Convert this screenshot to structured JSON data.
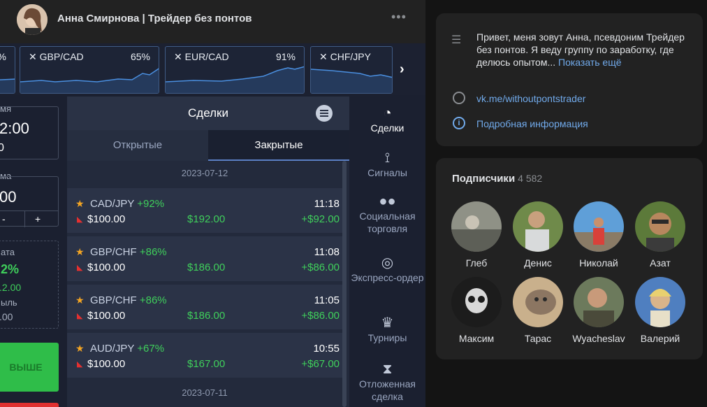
{
  "post": {
    "author": "Анна Смирнова | Трейдер без понтов",
    "menu": "•••"
  },
  "ticker": {
    "items": [
      {
        "pair": "",
        "percent": "%"
      },
      {
        "pair": "GBP/CAD",
        "percent": "65%"
      },
      {
        "pair": "EUR/CAD",
        "percent": "91%"
      },
      {
        "pair": "CHF/JPY",
        "percent": ""
      }
    ],
    "next": "›"
  },
  "left_panel": {
    "time_label": "мя",
    "time_value": "2:00",
    "time_sub": "0",
    "amount_label": "ма",
    "amount_value": "00",
    "minus": "-",
    "plus": "+",
    "payout_label": "ата",
    "payout_pct": "2%",
    "payout_value": ".2.00",
    "profit_label": "ыль",
    "profit_value": ".00",
    "up_button": "ВЫШЕ"
  },
  "deals": {
    "title": "Сделки",
    "tab_open": "Открытые",
    "tab_closed": "Закрытые",
    "date1": "2023-07-12",
    "date2": "2023-07-11",
    "trades": [
      {
        "pair": "CAD/JPY",
        "pct": "+92%",
        "amount": "$100.00",
        "payout": "$192.00",
        "time": "11:18",
        "profit": "+$92.00"
      },
      {
        "pair": "GBP/CHF",
        "pct": "+86%",
        "amount": "$100.00",
        "payout": "$186.00",
        "time": "11:08",
        "profit": "+$86.00"
      },
      {
        "pair": "GBP/CHF",
        "pct": "+86%",
        "amount": "$100.00",
        "payout": "$186.00",
        "time": "11:05",
        "profit": "+$86.00"
      },
      {
        "pair": "AUD/JPY",
        "pct": "+67%",
        "amount": "$100.00",
        "payout": "$167.00",
        "time": "10:55",
        "profit": "+$67.00"
      }
    ]
  },
  "nav": {
    "deals": "Сделки",
    "signals": "Сигналы",
    "social": "Социальная торговля",
    "express": "Экспресс-ордер",
    "tournaments": "Турниры",
    "pending": "Отложенная сделка"
  },
  "about": {
    "text": "Привет, меня зовут Анна, псевдоним Трейдер без понтов. Я веду группу по заработку, где делюсь опытом...",
    "more": "Показать ещё",
    "link": "vk.me/withoutpontstrader",
    "info": "Подробная информация"
  },
  "subscribers": {
    "title": "Подписчики",
    "count": "4 582",
    "people": [
      "Глеб",
      "Денис",
      "Николай",
      "Азат",
      "Максим",
      "Тарас",
      "Wyacheslav",
      "Валерий"
    ]
  },
  "colors": {
    "accent_link": "#71aaeb",
    "profit_green": "#3fcf5b",
    "up_button": "#2fbd49",
    "down_red": "#e03030"
  }
}
